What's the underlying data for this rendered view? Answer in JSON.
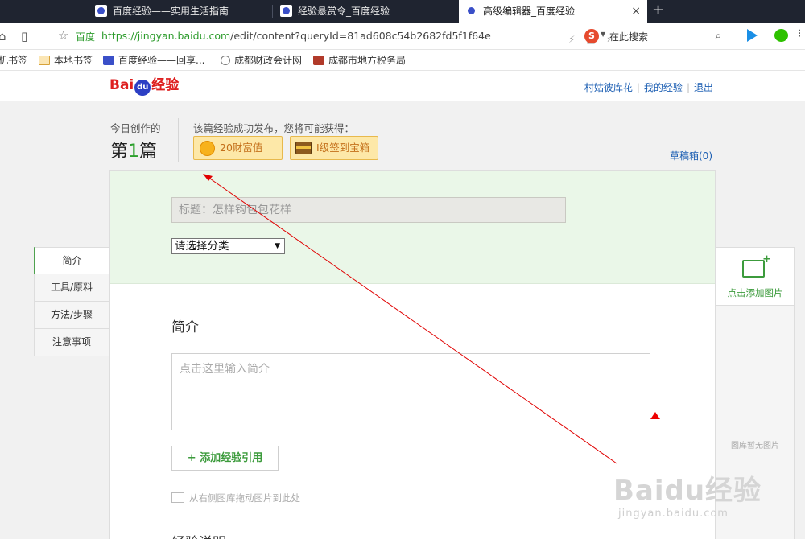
{
  "browser": {
    "tabs": [
      {
        "title": "百度经验——实用生活指南",
        "active": false
      },
      {
        "title": "经验悬赏令_百度经验",
        "active": false
      },
      {
        "title": "高级编辑器_百度经验",
        "active": true
      }
    ],
    "close_glyph": "×",
    "new_tab_glyph": "+",
    "address": {
      "site_label": "百度",
      "url_scheme_host": "https://jingyan.baidu.com",
      "url_path": "/edit/content?queryId=81ad608c54b2682fd5f1f64e"
    },
    "search_engine_glyph": "S",
    "search_placeholder": "在此搜索",
    "bookmarks": [
      {
        "label": "机书签",
        "icon": "none"
      },
      {
        "label": "本地书签",
        "icon": "folder-icon"
      },
      {
        "label": "百度经验——回享...",
        "icon": "baidu-paw-icon"
      },
      {
        "label": "成都财政会计网",
        "icon": "globe-icon"
      },
      {
        "label": "成都市地方税务局",
        "icon": "tax-bureau-icon"
      }
    ]
  },
  "site": {
    "logo": {
      "bai": "Bai",
      "du": "du",
      "jy": "经验"
    },
    "user_links": [
      "村姑彼库花",
      "我的经验",
      "退出"
    ]
  },
  "stats": {
    "today_label": "今日创作的",
    "today_prefix": "第",
    "today_number": "1",
    "today_suffix": "篇",
    "reward_title": "该篇经验成功发布，您将可能获得：",
    "reward_wealth": "20财富值",
    "reward_level": "I级",
    "reward_chest": "签到宝箱",
    "drafts": "草稿箱(0)"
  },
  "editor": {
    "title_placeholder": "标题：怎样钩包包花样",
    "category_selected": "请选择分类",
    "intro_heading": "简介",
    "intro_placeholder": "点击这里输入简介",
    "add_reference": "+ 添加经验引用",
    "drag_hint": "从右侧图库拖动图片到此处",
    "next_heading": "经验说明"
  },
  "side_nav": [
    "简介",
    "工具/原料",
    "方法/步骤",
    "注意事项"
  ],
  "image_panel": {
    "add_label": "点击添加图片",
    "empty_label": "图库暂无图片"
  },
  "watermark": {
    "logo": "Baidu经验",
    "url": "jingyan.baidu.com"
  },
  "colors": {
    "accent_green": "#3c9b3c",
    "link_blue": "#1d5fb3",
    "annotation_red": "#e00000"
  }
}
